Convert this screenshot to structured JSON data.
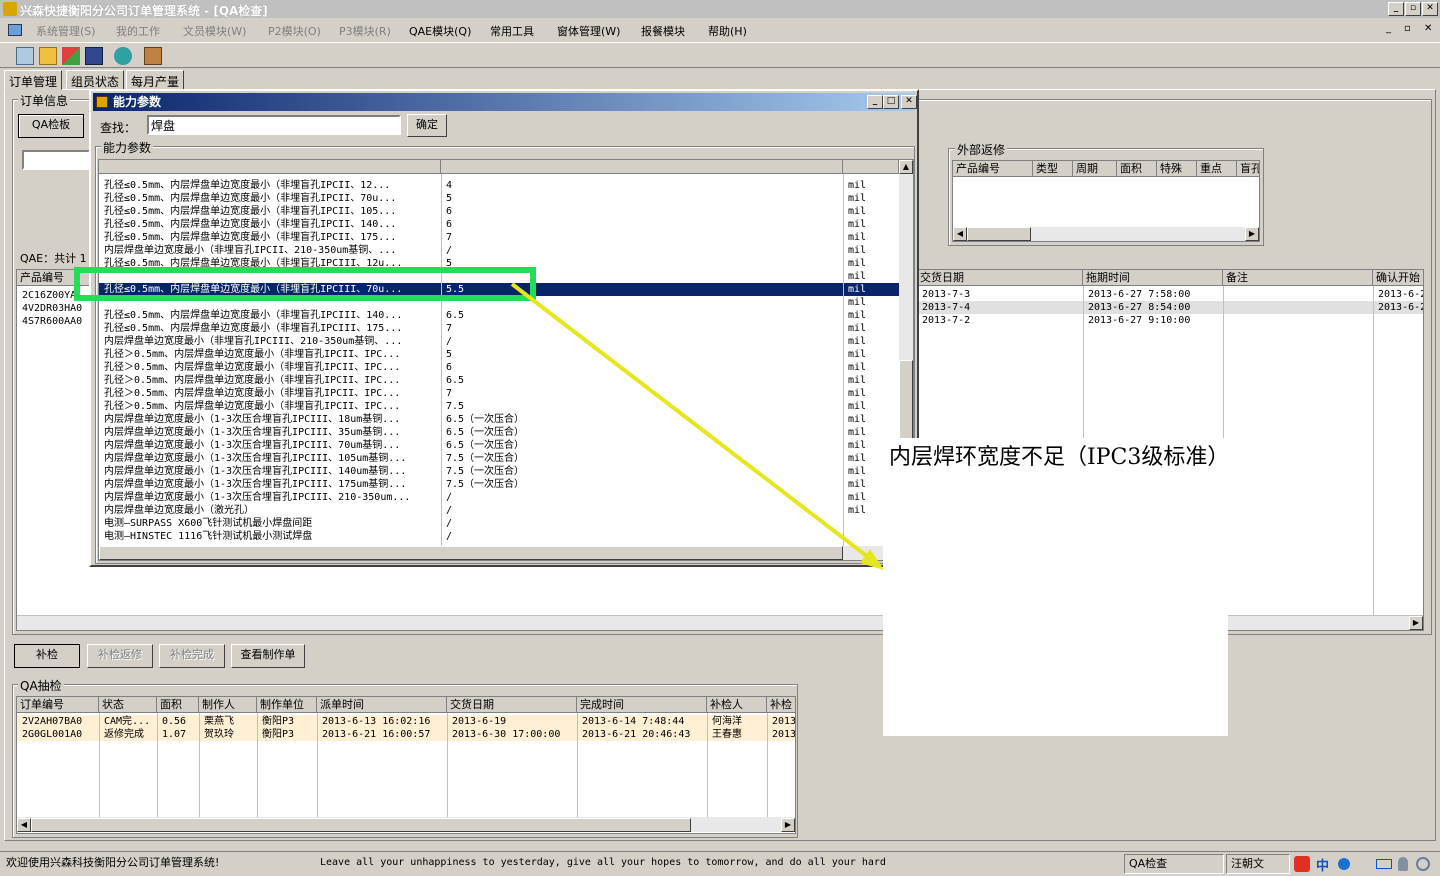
{
  "window": {
    "title": "兴森快捷衡阳分公司订单管理系统 - [QA检查]",
    "controls": [
      "_",
      "▫",
      "✕"
    ]
  },
  "menu": {
    "items": [
      "系统管理(S)",
      "我的工作",
      "文员模块(W)",
      "P2模块(O)",
      "P3模块(R)",
      "QAE模块(Q)",
      "常用工具",
      "窗体管理(W)",
      "报餐模块",
      "帮助(H)"
    ],
    "disabled": [
      0,
      1,
      2,
      3,
      4
    ]
  },
  "tabs": [
    "订单管理",
    "组员状态",
    "每月产量"
  ],
  "order_info": {
    "group_label": "订单信息",
    "qa_button": "QA检板",
    "qae_count_label": "QAE：共计 1"
  },
  "left_grid": {
    "header": "产品编号",
    "rows": [
      "2C16Z00YA",
      "4V2DR03HA0",
      "4S7R600AA0"
    ]
  },
  "right_grid": {
    "headers": [
      "交货日期",
      "拖期时间",
      "备注",
      "确认开始"
    ],
    "rows": [
      [
        "2013-7-3",
        "2013-6-27 7:58:00",
        "",
        "2013-6-2"
      ],
      [
        "2013-7-4",
        "2013-6-27 8:54:00",
        "",
        "2013-6-2"
      ],
      [
        "2013-7-2",
        "2013-6-27 9:10:00",
        "",
        ""
      ]
    ]
  },
  "external_return": {
    "group_label": "外部返修",
    "headers": [
      "产品编号",
      "类型",
      "周期",
      "面积",
      "特殊",
      "重点",
      "盲孔"
    ]
  },
  "actions": {
    "recheck": "补检",
    "recheck_return": "补检返修",
    "recheck_done": "补检完成",
    "view_job": "查看制作单"
  },
  "qa_sampling": {
    "group_label": "QA抽检",
    "headers": [
      "订单编号",
      "状态",
      "面积",
      "制作人",
      "制作单位",
      "派单时间",
      "交货日期",
      "完成时间",
      "补检人",
      "补检"
    ],
    "rows": [
      [
        "2V2AH07BA0",
        "CAM完...",
        "0.56",
        "栗燕飞",
        "衡阳P3",
        "2013-6-13 16:02:16",
        "2013-6-19",
        "2013-6-14 7:48:44",
        "何海洋",
        "2013"
      ],
      [
        "2G0GL001A0",
        "返修完成",
        "1.07",
        "贺玖玲",
        "衡阳P3",
        "2013-6-21 16:00:57",
        "2013-6-30 17:00:00",
        "2013-6-21 20:46:43",
        "王春惠",
        "2013"
      ]
    ]
  },
  "dialog": {
    "title": "能力参数",
    "search_label": "查找：",
    "search_value": "焊盘",
    "ok_button": "确定",
    "group_label": "能力参数",
    "selected_index": 8,
    "rows": [
      [
        "孔径≤0.5mm、内层焊盘单边宽度最小（非埋盲孔IPCII、12...",
        "4",
        "mil"
      ],
      [
        "孔径≤0.5mm、内层焊盘单边宽度最小（非埋盲孔IPCII、70u...",
        "5",
        "mil"
      ],
      [
        "孔径≤0.5mm、内层焊盘单边宽度最小（非埋盲孔IPCII、105...",
        "6",
        "mil"
      ],
      [
        "孔径≤0.5mm、内层焊盘单边宽度最小（非埋盲孔IPCII、140...",
        "6",
        "mil"
      ],
      [
        "孔径≤0.5mm、内层焊盘单边宽度最小（非埋盲孔IPCII、175...",
        "7",
        "mil"
      ],
      [
        "内层焊盘单边宽度最小（非埋盲孔IPCII、210-350um基铜、...",
        "/",
        "mil"
      ],
      [
        "孔径≤0.5mm、内层焊盘单边宽度最小（非埋盲孔IPCIII、12u...",
        "5",
        "mil"
      ],
      [
        "",
        "",
        "mil"
      ],
      [
        "孔径≤0.5mm、内层焊盘单边宽度最小（非埋盲孔IPCIII、70u...",
        "5.5",
        "mil"
      ],
      [
        "",
        "",
        "mil"
      ],
      [
        "孔径≤0.5mm、内层焊盘单边宽度最小（非埋盲孔IPCIII、140...",
        "6.5",
        "mil"
      ],
      [
        "孔径≤0.5mm、内层焊盘单边宽度最小（非埋盲孔IPCIII、175...",
        "7",
        "mil"
      ],
      [
        "内层焊盘单边宽度最小（非埋盲孔IPCIII、210-350um基铜、...",
        "/",
        "mil"
      ],
      [
        "孔径＞0.5mm、内层焊盘单边宽度最小（非埋盲孔IPCII、IPC...",
        "5",
        "mil"
      ],
      [
        "孔径＞0.5mm、内层焊盘单边宽度最小（非埋盲孔IPCII、IPC...",
        "6",
        "mil"
      ],
      [
        "孔径＞0.5mm、内层焊盘单边宽度最小（非埋盲孔IPCII、IPC...",
        "6.5",
        "mil"
      ],
      [
        "孔径＞0.5mm、内层焊盘单边宽度最小（非埋盲孔IPCII、IPC...",
        "7",
        "mil"
      ],
      [
        "孔径＞0.5mm、内层焊盘单边宽度最小（非埋盲孔IPCII、IPC...",
        "7.5",
        "mil"
      ],
      [
        "内层焊盘单边宽度最小（1-3次压合埋盲孔IPCIII、18um基铜...",
        "6.5（一次压合）",
        "mil"
      ],
      [
        "内层焊盘单边宽度最小（1-3次压合埋盲孔IPCIII、35um基铜...",
        "6.5（一次压合）",
        "mil"
      ],
      [
        "内层焊盘单边宽度最小（1-3次压合埋盲孔IPCIII、70um基铜...",
        "6.5（一次压合）",
        "mil"
      ],
      [
        "内层焊盘单边宽度最小（1-3次压合埋盲孔IPCIII、105um基铜...",
        "7.5（一次压合）",
        "mil"
      ],
      [
        "内层焊盘单边宽度最小（1-3次压合埋盲孔IPCIII、140um基铜...",
        "7.5（一次压合）",
        "mil"
      ],
      [
        "内层焊盘单边宽度最小（1-3次压合埋盲孔IPCIII、175um基铜...",
        "7.5（一次压合）",
        "mil"
      ],
      [
        "内层焊盘单边宽度最小（1-3次压合埋盲孔IPCIII、210-350um...",
        "/",
        "mil"
      ],
      [
        "内层焊盘单边宽度最小（激光孔）",
        "/",
        "mil"
      ],
      [
        "电测—SURPASS X600飞针测试机最小焊盘间距",
        "/",
        ""
      ],
      [
        "电测—HINSTEC 1116飞针测试机最小测试焊盘",
        "/",
        ""
      ]
    ]
  },
  "annotation": {
    "text": "内层焊环宽度不足（IPC3级标准）"
  },
  "status": {
    "welcome": "欢迎使用兴森科技衡阳分公司订单管理系统!",
    "motto": "Leave all your unhappiness to yesterday, give all your hopes to tomorrow, and do all your hard",
    "module": "QA检查",
    "user": "汪朝文",
    "ime": "中"
  },
  "colors": {
    "selection": "#0a246a",
    "highlight_box": "#22dd55",
    "arrow": "#e6e61e",
    "row_alt": "#ffefd5"
  }
}
